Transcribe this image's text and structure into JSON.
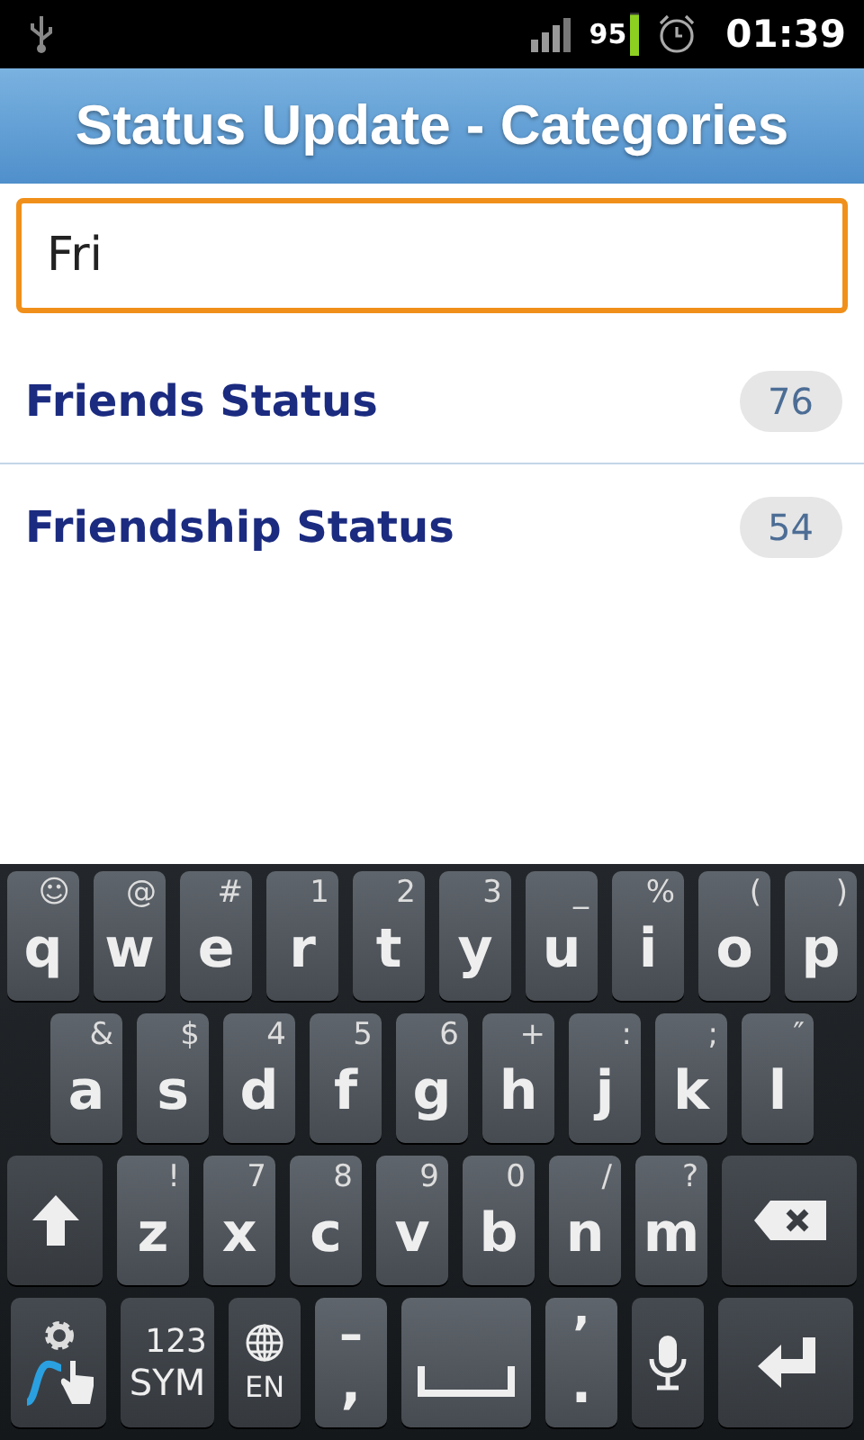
{
  "status_bar": {
    "battery": "95",
    "time": "01:39"
  },
  "title": "Status Update - Categories",
  "search": {
    "value": "Fri",
    "focused": true
  },
  "categories": [
    {
      "name": "Friends Status",
      "count": "76"
    },
    {
      "name": "Friendship Status",
      "count": "54"
    }
  ],
  "keyboard": {
    "rows": [
      {
        "keys": [
          {
            "kind": "letter",
            "main": "q",
            "hint": "☺"
          },
          {
            "kind": "letter",
            "main": "w",
            "hint": "@"
          },
          {
            "kind": "letter",
            "main": "e",
            "hint": "#"
          },
          {
            "kind": "letter",
            "main": "r",
            "hint": "1"
          },
          {
            "kind": "letter",
            "main": "t",
            "hint": "2"
          },
          {
            "kind": "letter",
            "main": "y",
            "hint": "3"
          },
          {
            "kind": "letter",
            "main": "u",
            "hint": "_"
          },
          {
            "kind": "letter",
            "main": "i",
            "hint": "%"
          },
          {
            "kind": "letter",
            "main": "o",
            "hint": "("
          },
          {
            "kind": "letter",
            "main": "p",
            "hint": ")"
          }
        ]
      },
      {
        "keys": [
          {
            "kind": "letter",
            "main": "a",
            "hint": "&"
          },
          {
            "kind": "letter",
            "main": "s",
            "hint": "$"
          },
          {
            "kind": "letter",
            "main": "d",
            "hint": "4"
          },
          {
            "kind": "letter",
            "main": "f",
            "hint": "5"
          },
          {
            "kind": "letter",
            "main": "g",
            "hint": "6"
          },
          {
            "kind": "letter",
            "main": "h",
            "hint": "+"
          },
          {
            "kind": "letter",
            "main": "j",
            "hint": ":"
          },
          {
            "kind": "letter",
            "main": "k",
            "hint": ";"
          },
          {
            "kind": "letter",
            "main": "l",
            "hint": "″"
          }
        ]
      },
      {
        "keys": [
          {
            "kind": "shift"
          },
          {
            "kind": "letter",
            "main": "z",
            "hint": "!"
          },
          {
            "kind": "letter",
            "main": "x",
            "hint": "7"
          },
          {
            "kind": "letter",
            "main": "c",
            "hint": "8"
          },
          {
            "kind": "letter",
            "main": "v",
            "hint": "9"
          },
          {
            "kind": "letter",
            "main": "b",
            "hint": "0"
          },
          {
            "kind": "letter",
            "main": "n",
            "hint": "/"
          },
          {
            "kind": "letter",
            "main": "m",
            "hint": "?"
          },
          {
            "kind": "backspace"
          }
        ]
      },
      {
        "keys": [
          {
            "kind": "settings"
          },
          {
            "kind": "sym",
            "main": "SYM",
            "hint": "123"
          },
          {
            "kind": "lang",
            "main": "EN"
          },
          {
            "kind": "punct",
            "main": ",",
            "hint": "–"
          },
          {
            "kind": "space"
          },
          {
            "kind": "punct",
            "main": ".",
            "hint": "’"
          },
          {
            "kind": "mic"
          },
          {
            "kind": "enter"
          }
        ]
      }
    ]
  }
}
